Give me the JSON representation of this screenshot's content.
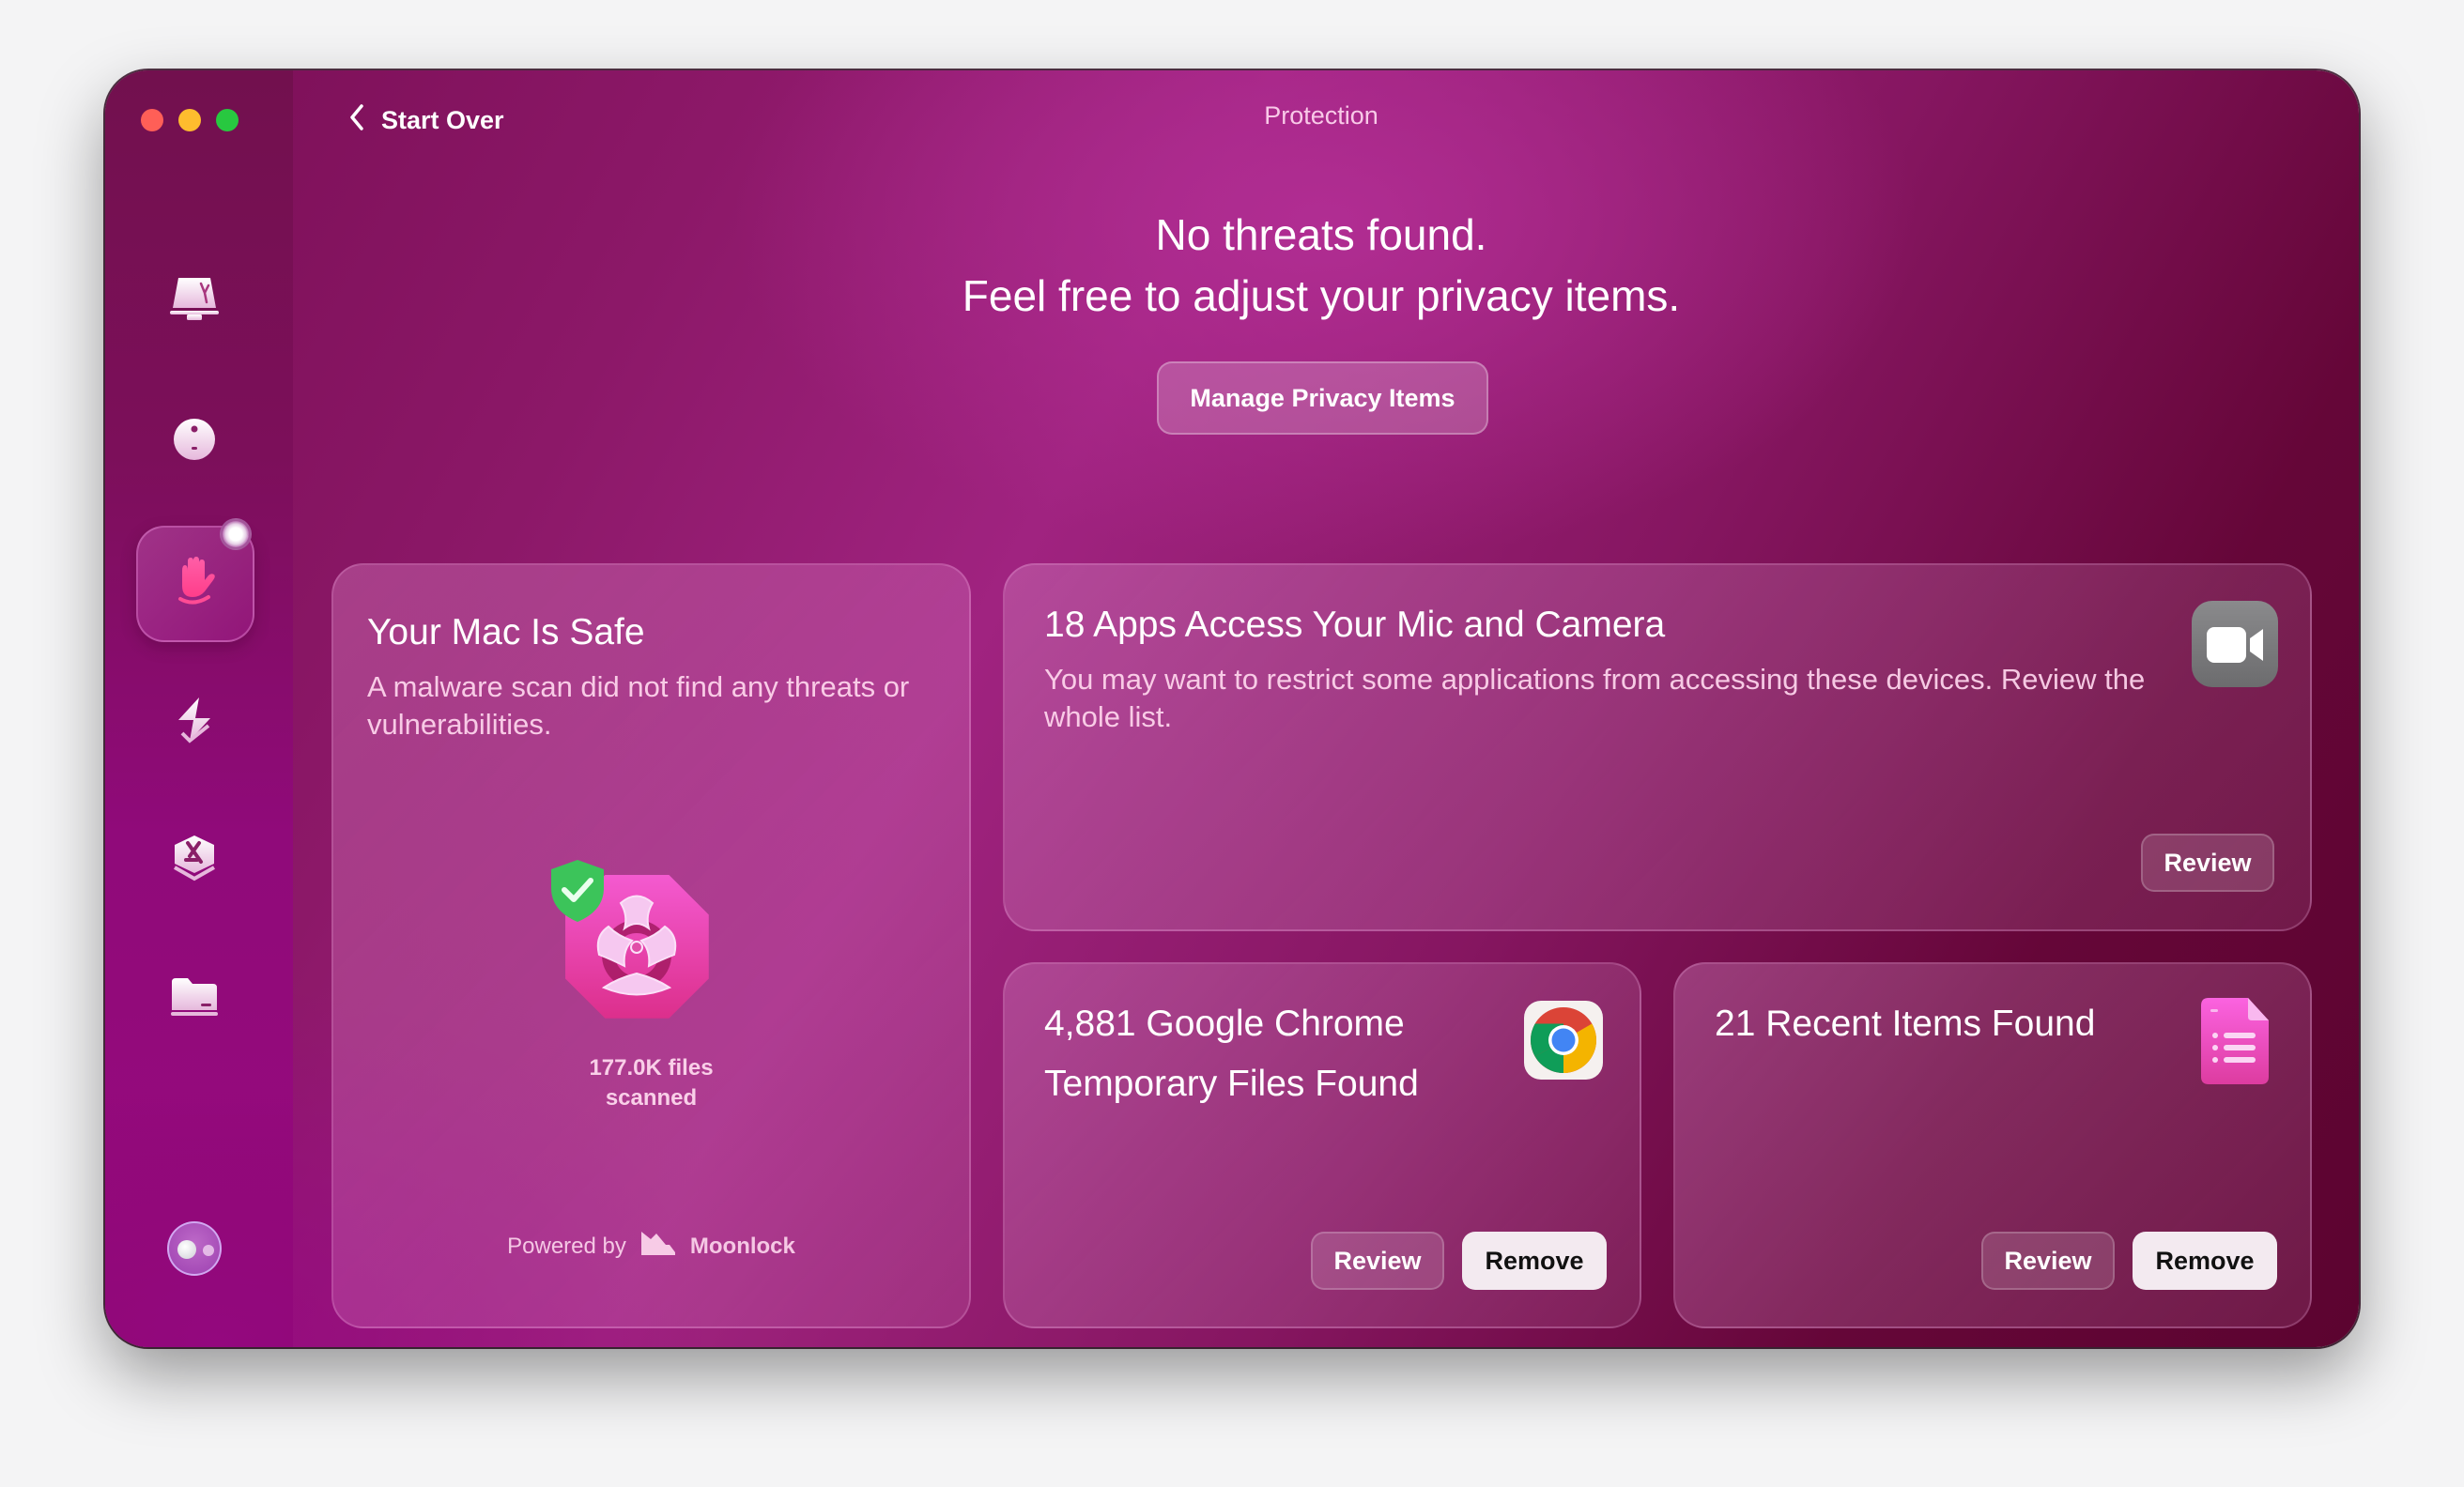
{
  "window": {
    "title": "Protection",
    "back_label": "Start Over",
    "traffic_lights": [
      "close",
      "minimize",
      "maximize"
    ]
  },
  "colors": {
    "accent": "#a02380",
    "close": "#ff5f57",
    "minimize": "#febc2e",
    "maximize": "#28c840",
    "shield_green": "#3cc45a",
    "biohazard_pink": "#e8399f"
  },
  "sidebar": {
    "items": [
      {
        "name": "smart-care",
        "icon": "monitor-icon",
        "selected": false
      },
      {
        "name": "cleanup",
        "icon": "disc-icon",
        "selected": false
      },
      {
        "name": "protection",
        "icon": "hand-icon",
        "selected": true
      },
      {
        "name": "performance",
        "icon": "lightning-icon",
        "selected": false
      },
      {
        "name": "applications",
        "icon": "app-store-icon",
        "selected": false
      },
      {
        "name": "my-clutter",
        "icon": "folder-icon",
        "selected": false
      }
    ],
    "assistant_icon": "assistant-icon"
  },
  "hero": {
    "line1": "No threats found.",
    "line2": "Feel free to adjust your privacy items.",
    "button_label": "Manage Privacy Items"
  },
  "cards": {
    "safe": {
      "title": "Your Mac Is Safe",
      "description": "A malware scan did not find any threats or vulnerabilities.",
      "files_scanned_line1": "177.0K files",
      "files_scanned_line2": "scanned",
      "powered_by": "Powered by",
      "brand": "Moonlock"
    },
    "mic_camera": {
      "title": "18 Apps Access Your Mic and Camera",
      "description": "You may want to restrict some applications from accessing these devices. Review the whole list.",
      "review_label": "Review",
      "icon": "facetime-camera-icon"
    },
    "chrome": {
      "title": "4,881 Google Chrome Temporary Files Found",
      "review_label": "Review",
      "remove_label": "Remove",
      "icon": "chrome-icon"
    },
    "recent": {
      "title": "21 Recent Items Found",
      "review_label": "Review",
      "remove_label": "Remove",
      "icon": "document-list-icon"
    }
  }
}
